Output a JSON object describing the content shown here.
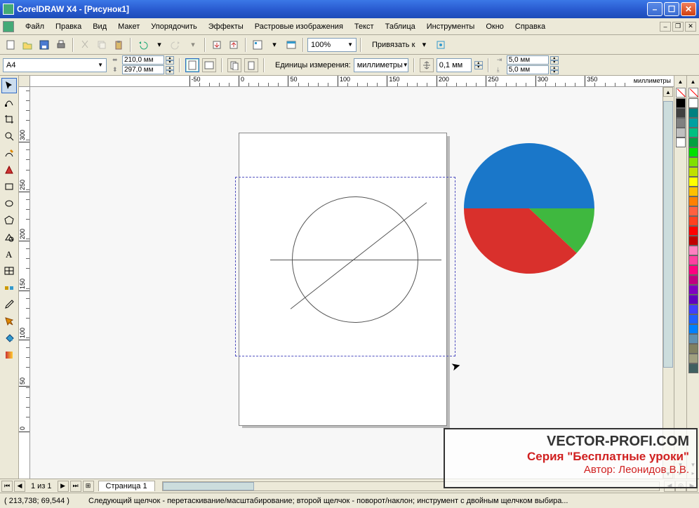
{
  "titlebar": {
    "title": "CorelDRAW X4 - [Рисунок1]"
  },
  "menu": {
    "file": "Файл",
    "edit": "Правка",
    "view": "Вид",
    "layout": "Макет",
    "arrange": "Упорядочить",
    "effects": "Эффекты",
    "bitmaps": "Растровые изображения",
    "text": "Текст",
    "table": "Таблица",
    "tools": "Инструменты",
    "window": "Окно",
    "help": "Справка"
  },
  "std_toolbar": {
    "zoom": "100%",
    "snap_label": "Привязать к"
  },
  "propbar": {
    "page_size": "A4",
    "width": "210,0 мм",
    "height": "297,0 мм",
    "units_label": "Единицы измерения:",
    "units": "миллиметры",
    "nudge": "0,1 мм",
    "dup_x": "5,0 мм",
    "dup_y": "5,0 мм"
  },
  "ruler": {
    "units_label": "миллиметры",
    "h_ticks": [
      -50,
      0,
      50,
      100,
      150,
      200,
      250,
      300,
      350
    ],
    "v_ticks": [
      0,
      50,
      100,
      150,
      200,
      250,
      300
    ]
  },
  "page_nav": {
    "of": "1 из 1",
    "tab": "Страница 1"
  },
  "statusbar": {
    "coords": "( 213,738; 69,544 )",
    "hint": "Следующий щелчок - перетаскивание/масштабирование; второй щелчок - поворот/наклон; инструмент с двойным щелчком выбира..."
  },
  "palette1": [
    "#000000",
    "#404040",
    "#808080",
    "#c0c0c0",
    "#ffffff"
  ],
  "palette2": [
    "#ffffff",
    "#008080",
    "#00a0a0",
    "#00c080",
    "#00a040",
    "#00e000",
    "#80e000",
    "#c0e000",
    "#ffff00",
    "#ffc000",
    "#ff8000",
    "#ff6040",
    "#ff4020",
    "#ff0000",
    "#c00000",
    "#ff80c0",
    "#ff40a0",
    "#ff0080",
    "#c00080",
    "#8000c0",
    "#6000c0",
    "#4040ff",
    "#2060ff",
    "#0080ff",
    "#6090b0",
    "#808060",
    "#a0a080",
    "#406060"
  ],
  "chart_data": {
    "type": "pie",
    "title": "",
    "series": [
      {
        "name": "blue",
        "value": 50,
        "color": "#1a77c9"
      },
      {
        "name": "green",
        "value": 12,
        "color": "#3fb83f"
      },
      {
        "name": "red",
        "value": 38,
        "color": "#d9302c"
      }
    ]
  },
  "watermark": {
    "l1": "VECTOR-PROFI.COM",
    "l2": "Серия \"Бесплатные уроки\"",
    "l3": "Автор: Леонидов  В.В."
  }
}
